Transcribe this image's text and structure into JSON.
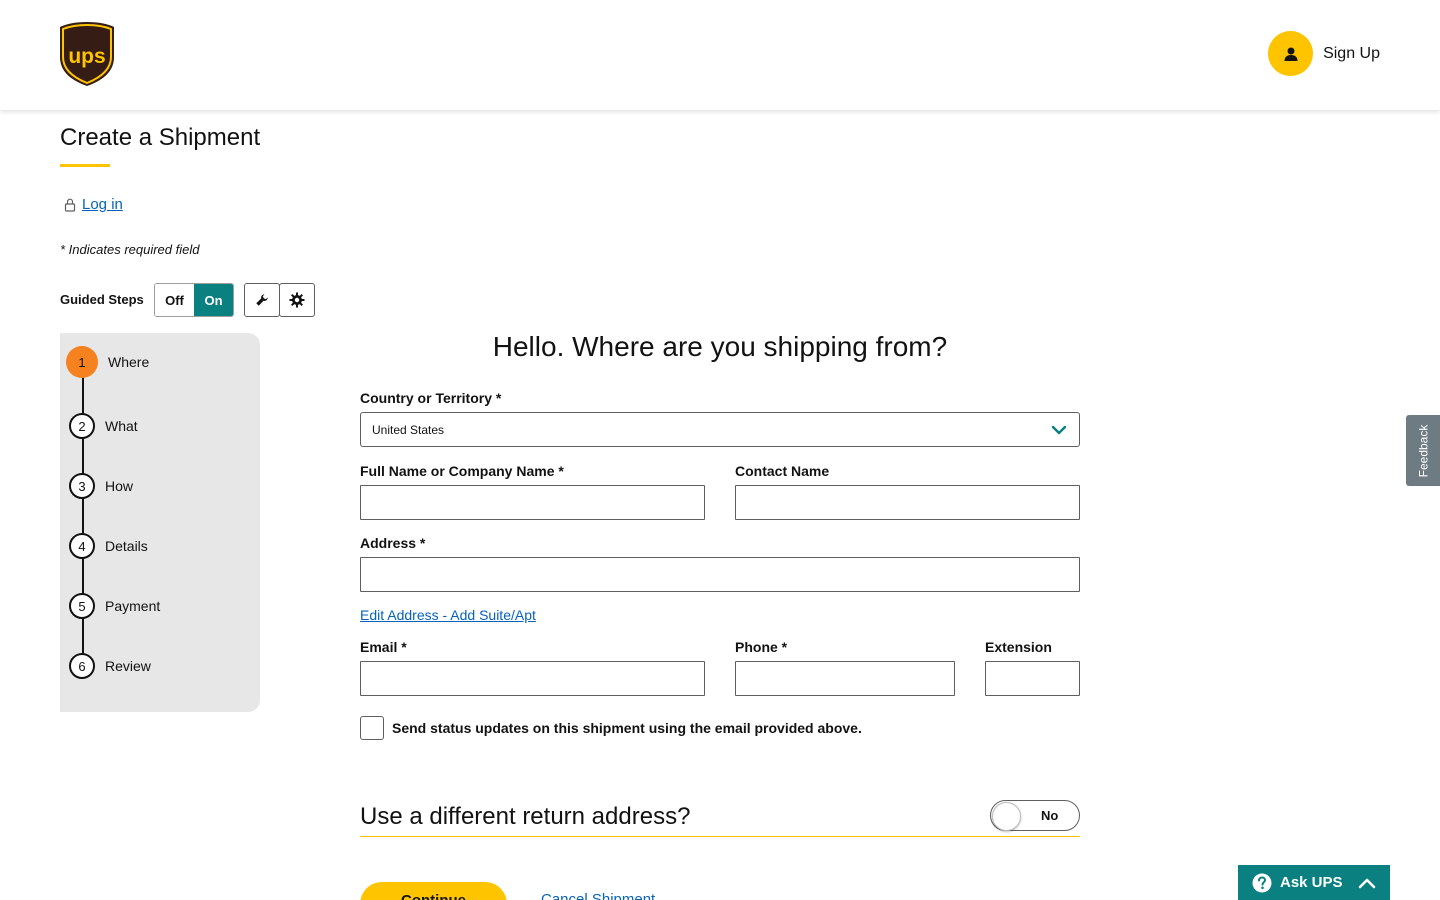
{
  "header": {
    "logo_text": "ups",
    "signup_label": "Sign Up"
  },
  "page": {
    "title": "Create a Shipment",
    "login_label": "Log in",
    "required_note": "* Indicates required field"
  },
  "guided_steps": {
    "label": "Guided Steps",
    "off_label": "Off",
    "on_label": "On",
    "selected": "On"
  },
  "stepper": {
    "steps": [
      {
        "number": "1",
        "label": "Where"
      },
      {
        "number": "2",
        "label": "What"
      },
      {
        "number": "3",
        "label": "How"
      },
      {
        "number": "4",
        "label": "Details"
      },
      {
        "number": "5",
        "label": "Payment"
      },
      {
        "number": "6",
        "label": "Review"
      }
    ],
    "active_step": 1
  },
  "form": {
    "heading": "Hello. Where are you shipping from?",
    "country_label": "Country or Territory *",
    "country_value": "United States",
    "full_name_label": "Full Name or Company Name *",
    "full_name_value": "",
    "contact_name_label": "Contact Name",
    "contact_name_value": "",
    "address_label": "Address *",
    "address_value": "",
    "edit_address_link": "Edit Address - Add Suite/Apt",
    "email_label": "Email *",
    "email_value": "",
    "phone_label": "Phone *",
    "phone_value": "",
    "extension_label": "Extension",
    "extension_value": "",
    "status_updates_label": "Send status updates on this shipment using the email provided above.",
    "status_updates_checked": false
  },
  "return_address": {
    "heading": "Use a different return address?",
    "toggle_label": "No"
  },
  "actions": {
    "continue_label": "Continue",
    "cancel_label": "Cancel Shipment"
  },
  "feedback": {
    "label": "Feedback"
  },
  "ask_ups": {
    "label": "Ask UPS"
  },
  "colors": {
    "brand_yellow": "#ffc400",
    "brand_brown": "#351c15",
    "teal": "#0a8080",
    "active_step_orange": "#f5821f",
    "link_blue": "#0662bb",
    "stepper_bg": "#e7e7e7"
  }
}
